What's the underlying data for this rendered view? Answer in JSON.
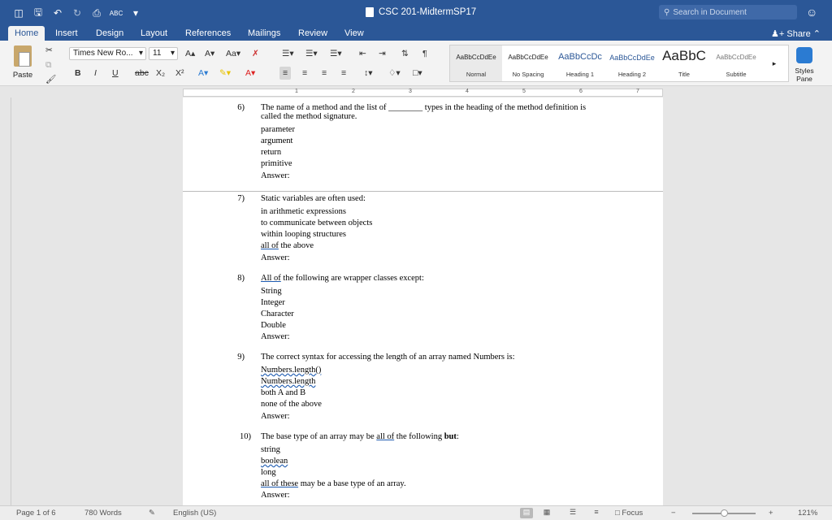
{
  "window": {
    "title": "CSC 201-MidtermSP17",
    "search_placeholder": "Search in Document"
  },
  "tabs": [
    {
      "label": "Home",
      "active": true
    },
    {
      "label": "Insert"
    },
    {
      "label": "Design"
    },
    {
      "label": "Layout"
    },
    {
      "label": "References"
    },
    {
      "label": "Mailings"
    },
    {
      "label": "Review"
    },
    {
      "label": "View"
    }
  ],
  "share_label": "Share",
  "ribbon": {
    "paste_label": "Paste",
    "font_name": "Times New Ro...",
    "font_size": "11",
    "bold": "B",
    "italic": "I",
    "underline": "U",
    "strike": "abc",
    "styles": [
      {
        "preview": "AaBbCcDdEe",
        "name": "Normal"
      },
      {
        "preview": "AaBbCcDdEe",
        "name": "No Spacing"
      },
      {
        "preview": "AaBbCcDc",
        "name": "Heading 1"
      },
      {
        "preview": "AaBbCcDdEe",
        "name": "Heading 2"
      },
      {
        "preview": "AaBbC",
        "name": "Title"
      },
      {
        "preview": "AaBbCcDdEe",
        "name": "Subtitle"
      }
    ],
    "styles_pane_label": "Styles Pane"
  },
  "ruler_numbers": [
    "1",
    "2",
    "3",
    "4",
    "5",
    "6",
    "7"
  ],
  "document": {
    "q6": {
      "num": "6)",
      "line1": "The name of a method and the list of ________ types in the heading of the method definition is",
      "line2": "called the method signature.",
      "options": [
        "parameter",
        "argument",
        "return",
        "primitive"
      ],
      "answer": "Answer:"
    },
    "q7": {
      "num": "7)",
      "text": "Static variables are often used:",
      "options": [
        "in arithmetic expressions",
        "to communicate between objects",
        "within looping structures"
      ],
      "opt4_pre": "all of",
      "opt4_post": " the above",
      "answer": "Answer:"
    },
    "q8": {
      "num": "8)",
      "text_pre": "All of",
      "text_post": " the following are wrapper classes except:",
      "options": [
        "String",
        "Integer",
        "Character",
        "Double"
      ],
      "answer": "Answer:"
    },
    "q9": {
      "num": "9)",
      "text": "The correct syntax for accessing the length of an array named Numbers is:",
      "opt1": "Numbers.length()",
      "opt2": "Numbers.length",
      "opt3": "both A and B",
      "opt4": "none of the above",
      "answer": "Answer:"
    },
    "q10": {
      "num": "10)",
      "text_pre": "The base type of an array may be ",
      "text_mid": "all of",
      "text_post": " the following ",
      "text_bold": "but",
      "text_end": ":",
      "opt1": "string",
      "opt2": "boolean",
      "opt3": "long",
      "opt4_pre": "all of these",
      "opt4_post": " may be a base type of an array.",
      "answer": "Answer:"
    }
  },
  "status": {
    "page": "Page 1 of 6",
    "words": "780 Words",
    "language": "English (US)",
    "focus": "Focus",
    "zoom": "121%",
    "zoom_minus": "−",
    "zoom_plus": "+"
  },
  "colors": {
    "title_bar": "#2b5797",
    "ribbon": "#f3f3f3",
    "squiggle": "#1e5bb0"
  }
}
